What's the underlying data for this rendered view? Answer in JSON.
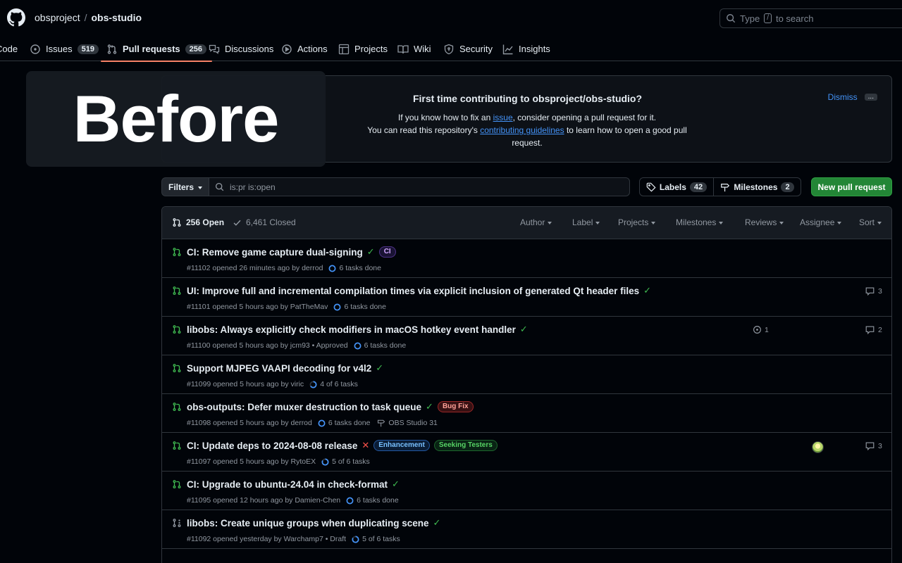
{
  "header": {
    "owner": "obsproject",
    "separator": "/",
    "repo": "obs-studio",
    "search_prefix": "Type",
    "search_key": "/",
    "search_suffix": "to search"
  },
  "nav": {
    "code": "Code",
    "issues": "Issues",
    "issues_count": "519",
    "pulls": "Pull requests",
    "pulls_count": "256",
    "discussions": "Discussions",
    "actions": "Actions",
    "projects": "Projects",
    "wiki": "Wiki",
    "security": "Security",
    "insights": "Insights"
  },
  "overlay_text": "Before",
  "banner": {
    "title": "First time contributing to obsproject/obs-studio?",
    "line1_pre": "If you know how to fix an ",
    "line1_link": "issue",
    "line1_post": ", consider opening a pull request for it.",
    "line2_pre": "You can read this repository's ",
    "line2_link": "contributing guidelines",
    "line2_post": " to learn how to open a good pull request.",
    "dismiss": "Dismiss",
    "dots": "..."
  },
  "filterbar": {
    "filters": "Filters",
    "query": "is:pr is:open",
    "labels": "Labels",
    "labels_count": "42",
    "milestones": "Milestones",
    "milestones_count": "2",
    "new_pr": "New pull request"
  },
  "list_header": {
    "open": "256 Open",
    "closed": "6,461 Closed",
    "author": "Author",
    "label": "Label",
    "projects": "Projects",
    "milestones": "Milestones",
    "reviews": "Reviews",
    "assignee": "Assignee",
    "sort": "Sort"
  },
  "rows": [
    {
      "title": "CI: Remove game capture dual-signing",
      "meta": "#11102 opened 26 minutes ago by derrod",
      "tasks": "6 tasks done"
    },
    {
      "title": "UI: Improve full and incremental compilation times via explicit inclusion of generated Qt header files",
      "meta": "#11101 opened 5 hours ago by PatTheMav",
      "tasks": "6 tasks done",
      "comments": "3"
    },
    {
      "title": "libobs: Always explicitly check modifiers in macOS hotkey event handler",
      "meta": "#11100 opened 5 hours ago by jcm93 • Approved",
      "tasks": "6 tasks done",
      "linked": "1",
      "comments": "2"
    },
    {
      "title": "Support MJPEG VAAPI decoding for v4l2",
      "meta": "#11099 opened 5 hours ago by viric",
      "tasks": "4 of 6 tasks"
    },
    {
      "title": "obs-outputs: Defer muxer destruction to task queue",
      "meta": "#11098 opened 5 hours ago by derrod",
      "tasks": "6 tasks done",
      "milestone": "OBS Studio 31"
    },
    {
      "title": "CI: Update deps to 2024-08-08 release",
      "meta": "#11097 opened 5 hours ago by RytoEX",
      "tasks": "5 of 6 tasks",
      "comments": "3"
    },
    {
      "title": "CI: Upgrade to ubuntu-24.04 in check-format",
      "meta": "#11095 opened 12 hours ago by Damien-Chen",
      "tasks": "6 tasks done"
    },
    {
      "title": "libobs: Create unique groups when duplicating scene",
      "meta": "#11092 opened yesterday by Warchamp7 • Draft",
      "tasks": "5 of 6 tasks"
    }
  ],
  "labels": {
    "ci": "CI",
    "bug": "Bug Fix",
    "enhancement": "Enhancement",
    "seeking": "Seeking Testers"
  },
  "colors": {
    "accent_underline": "#f78166",
    "open_green": "#3fb950",
    "link_blue": "#4493f8",
    "primary_button": "#238636"
  }
}
